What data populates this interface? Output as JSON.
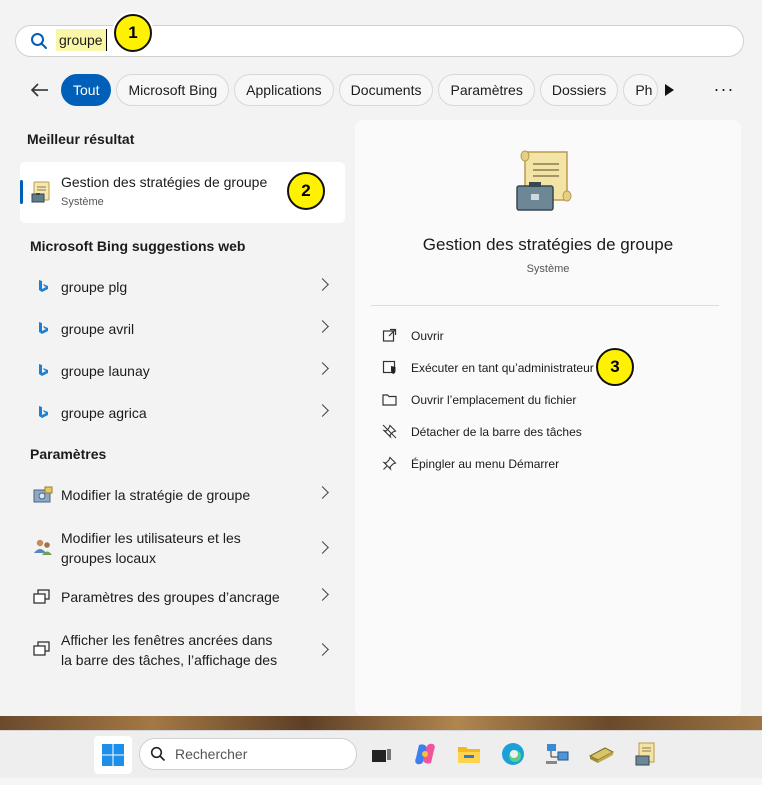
{
  "search": {
    "query": "groupe"
  },
  "badges": {
    "one": "1",
    "two": "2",
    "three": "3"
  },
  "tabs": [
    {
      "label": "Tout",
      "active": true
    },
    {
      "label": "Microsoft Bing"
    },
    {
      "label": "Applications"
    },
    {
      "label": "Documents"
    },
    {
      "label": "Paramètres"
    },
    {
      "label": "Dossiers"
    },
    {
      "label": "Ph"
    }
  ],
  "more_label": "···",
  "best_match": {
    "heading": "Meilleur résultat",
    "title": "Gestion des stratégies de groupe",
    "subtitle": "Système"
  },
  "bing": {
    "heading": "Microsoft Bing suggestions web",
    "items": [
      "groupe plg",
      "groupe avril",
      "groupe launay",
      "groupe agrica"
    ]
  },
  "settings": {
    "heading": "Paramètres",
    "items": [
      "Modifier la stratégie de groupe",
      "Modifier les utilisateurs et les",
      "groupes locaux",
      "Paramètres des groupes d’ancrage",
      "Afficher les fenêtres ancrées dans",
      "la barre des tâches, l’affichage des"
    ]
  },
  "preview": {
    "title": "Gestion des stratégies de groupe",
    "subtitle": "Système",
    "actions": [
      {
        "label": "Ouvrir",
        "icon": "open-external-icon"
      },
      {
        "label": "Exécuter en tant qu’administrateur",
        "icon": "shield-admin-icon"
      },
      {
        "label": "Ouvrir l’emplacement du fichier",
        "icon": "folder-icon"
      },
      {
        "label": "Détacher de la barre des tâches",
        "icon": "unpin-icon"
      },
      {
        "label": "Épingler au menu Démarrer",
        "icon": "pin-icon"
      }
    ]
  },
  "taskbar": {
    "search_placeholder": "Rechercher",
    "apps": [
      "task-view-icon",
      "copilot-icon",
      "file-explorer-icon",
      "edge-icon",
      "network-app-icon",
      "scanner-app-icon",
      "group-policy-app-icon"
    ]
  },
  "colors": {
    "accent": "#005fb8",
    "badge": "#fff200",
    "highlight": "#f9f6a8"
  }
}
